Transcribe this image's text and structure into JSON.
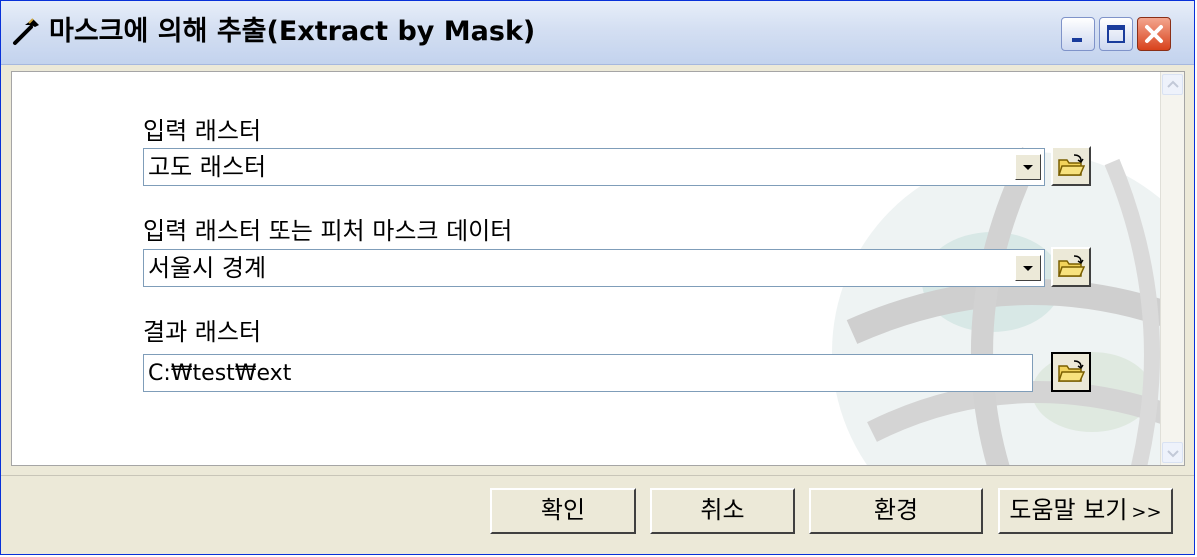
{
  "window": {
    "title": "마스크에 의해 추출(Extract by Mask)"
  },
  "form": {
    "input_raster": {
      "label": "입력 래스터",
      "value": "고도 래스터"
    },
    "mask_data": {
      "label": "입력 래스터 또는 피처 마스크 데이터",
      "value": "서울시 경계"
    },
    "output_raster": {
      "label": "결과 래스터",
      "value": "C:₩test₩ext"
    }
  },
  "buttons": {
    "ok": "확인",
    "cancel": "취소",
    "environments": "환경",
    "help": "도움말 보기",
    "help_suffix": ">>"
  },
  "icons": {
    "title": "hammer-icon",
    "browse": "open-folder-icon",
    "dropdown": "chevron-down-icon",
    "background": "globe-watermark"
  },
  "colors": {
    "titlebar": "#d4dff2",
    "close_button": "#d8421c",
    "dialog_face": "#ece9d8",
    "field_border": "#7f9db9"
  }
}
